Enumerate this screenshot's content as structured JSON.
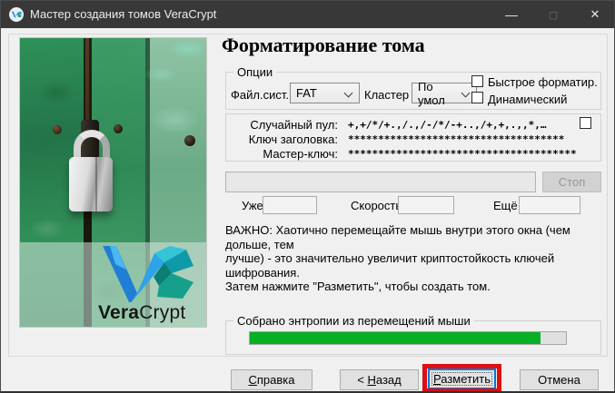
{
  "window": {
    "title": "Мастер создания томов VeraCrypt",
    "minimize_glyph": "—",
    "maximize_glyph": "▢",
    "close_glyph": "✕"
  },
  "logo": {
    "vera": "Vera",
    "crypt": "Crypt"
  },
  "page": {
    "heading": "Форматирование тома",
    "options": {
      "group_label": "Опции",
      "filesystem_label": "Файл.сист.",
      "filesystem_value": "FAT",
      "cluster_label": "Кластер",
      "cluster_value": "По умол",
      "quick_format": "Быстрое форматир.",
      "dynamic": "Динамический"
    },
    "pool": {
      "random_label": "Случайный пул:",
      "random_value": "+,+/*/+.,/.,/-/*/-+..,/+,+,.,,*,…",
      "header_key_label": "Ключ заголовка:",
      "header_key_value": "************************************",
      "master_key_label": "Мастер-ключ:",
      "master_key_value": "**************************************"
    },
    "format_progress": {
      "stop": "Стоп",
      "done_label": "Уже",
      "speed_label": "Скорость",
      "remaining_label": "Ещё",
      "done_value": "",
      "speed_value": "",
      "remaining_value": ""
    },
    "notice": {
      "line1": "ВАЖНО: Хаотично перемещайте мышь внутри этого окна (чем дольше, тем",
      "line2": "лучше) - это значительно увеличит криптостойкость ключей шифрования.",
      "line3": "Затем нажмите \"Разметить\", чтобы создать том."
    },
    "entropy": {
      "group_label": "Собрано энтропии из перемещений мыши",
      "percent": "92",
      "bar_style": "width:92%"
    }
  },
  "buttons": {
    "help_accel": "С",
    "help_rest": "правка",
    "back_pre": "< ",
    "back_accel": "Н",
    "back_rest": "азад",
    "format_accel": "Р",
    "format_rest": "азметить",
    "cancel": "Отмена"
  },
  "colors": {
    "titlebar": "#383838",
    "entropy_green": "#06b025",
    "annotation_red": "#dd0f0f",
    "focus_blue": "#0078d7"
  }
}
